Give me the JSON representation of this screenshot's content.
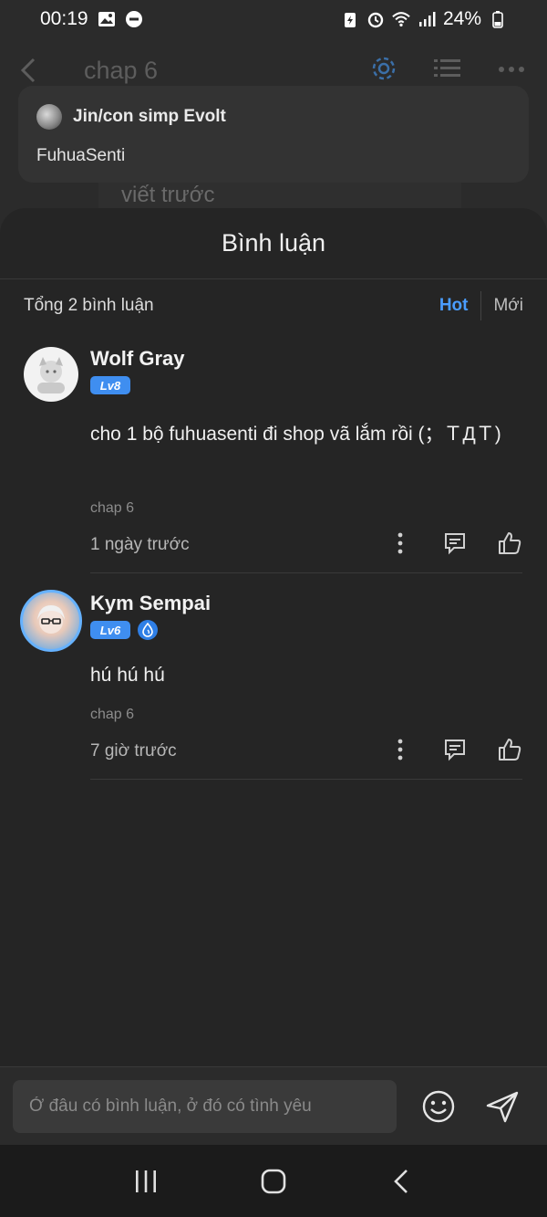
{
  "status_bar": {
    "time": "00:19",
    "battery": "24%"
  },
  "background": {
    "title": "chap 6",
    "partial_text": "viết trước"
  },
  "toast": {
    "sender": "Jin/con simp Evolt",
    "message": "FuhuaSenti"
  },
  "sheet": {
    "title": "Bình luận",
    "total": "Tổng 2 bình luận",
    "sort_hot": "Hot",
    "sort_new": "Mới"
  },
  "comments": [
    {
      "name": "Wolf Gray",
      "level": "Lv8",
      "text": "cho 1 bộ fuhuasenti đi shop vã lắm rồi (；ＴДＴ)",
      "chapter": "chap 6",
      "time": "1 ngày trước"
    },
    {
      "name": "Kym Sempai",
      "level": "Lv6",
      "text": "hú hú hú",
      "chapter": "chap 6",
      "time": "7 giờ trước"
    }
  ],
  "input": {
    "placeholder": "Ở đâu có bình luận, ở đó có tình yêu"
  },
  "colors": {
    "accent": "#4a9dff",
    "level_badge": "#3f8ef0",
    "sheet_bg": "#252525"
  },
  "icons": [
    "back-icon",
    "gear-icon",
    "list-icon",
    "more-icon",
    "kebab-icon",
    "reply-icon",
    "like-icon",
    "emoji-icon",
    "send-icon",
    "nav-recents-icon",
    "nav-home-icon",
    "nav-back-icon"
  ]
}
